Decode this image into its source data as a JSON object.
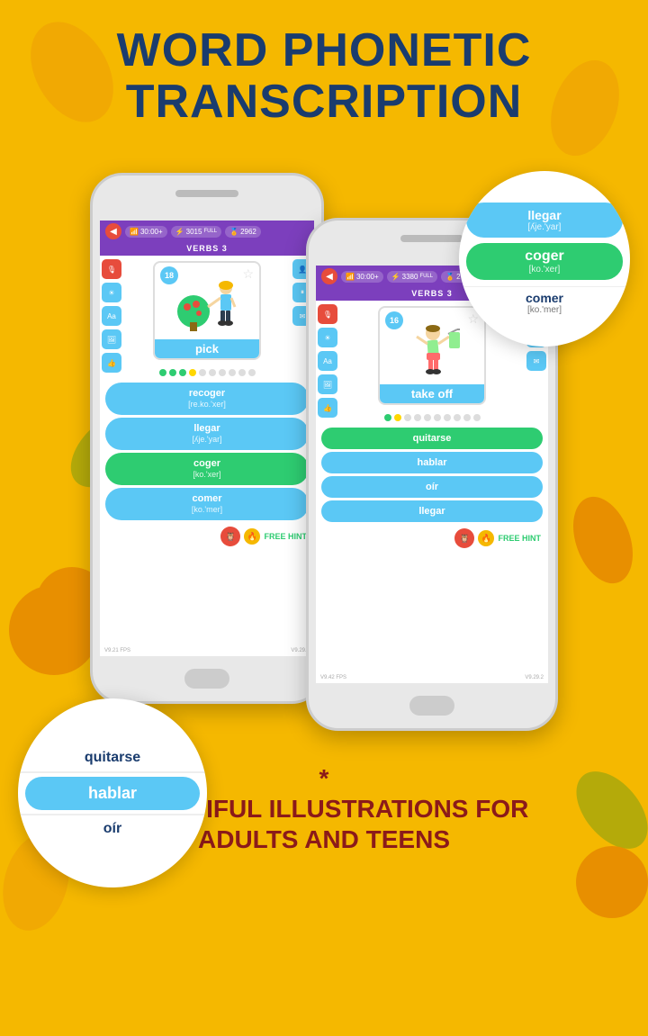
{
  "header": {
    "line1": "WORD PHONETIC",
    "line2": "TRANSCRIPTION"
  },
  "phone_left": {
    "status": {
      "time": "30:00+",
      "score": "3015",
      "score_label": "FULL",
      "medals": "2962"
    },
    "verbs_label": "VERBS 3",
    "card_number": "18",
    "card_word": "pick",
    "answers": [
      {
        "word": "recoger",
        "phonetic": "[re.ko.'xer]",
        "type": "blue"
      },
      {
        "word": "llegar",
        "phonetic": "[ʎje.'yar]",
        "type": "blue"
      },
      {
        "word": "coger",
        "phonetic": "[ko.'xer]",
        "type": "green"
      },
      {
        "word": "comer",
        "phonetic": "[ko.'mer]",
        "type": "blue"
      }
    ],
    "fps": "V9.21 FPS",
    "version": "V9.29.2"
  },
  "phone_right": {
    "status": {
      "time": "30:00+",
      "score": "3380",
      "score_label": "FULL",
      "medals": "2702"
    },
    "verbs_label": "VERBS 3",
    "card_number": "16",
    "card_word": "take off",
    "answers": [
      {
        "word": "quitarse",
        "type": "green"
      },
      {
        "word": "hablar",
        "type": "blue"
      },
      {
        "word": "oír",
        "type": "blue"
      },
      {
        "word": "llegar",
        "type": "blue"
      }
    ],
    "fps": "V9.42 FPS",
    "version": "V9.29.2"
  },
  "bubble_right": {
    "items": [
      {
        "word": "llegar",
        "phonetic": "[ʎje.'yar]",
        "color": "blue"
      },
      {
        "word": "coger",
        "phonetic": "[ko.'xer]",
        "color": "green"
      },
      {
        "word": "comer",
        "phonetic": "[ko.'mer]",
        "color": "white"
      }
    ]
  },
  "bubble_left": {
    "items": [
      {
        "word": "quitarse",
        "color": "white"
      },
      {
        "word": "hablar",
        "color": "blue"
      },
      {
        "word": "oír",
        "color": "white"
      }
    ]
  },
  "footer": {
    "asterisk": "*",
    "line1": "BEAUTIFUL ILLUSTRATIONS FOR",
    "line2": "ADULTS AND TEENS"
  }
}
